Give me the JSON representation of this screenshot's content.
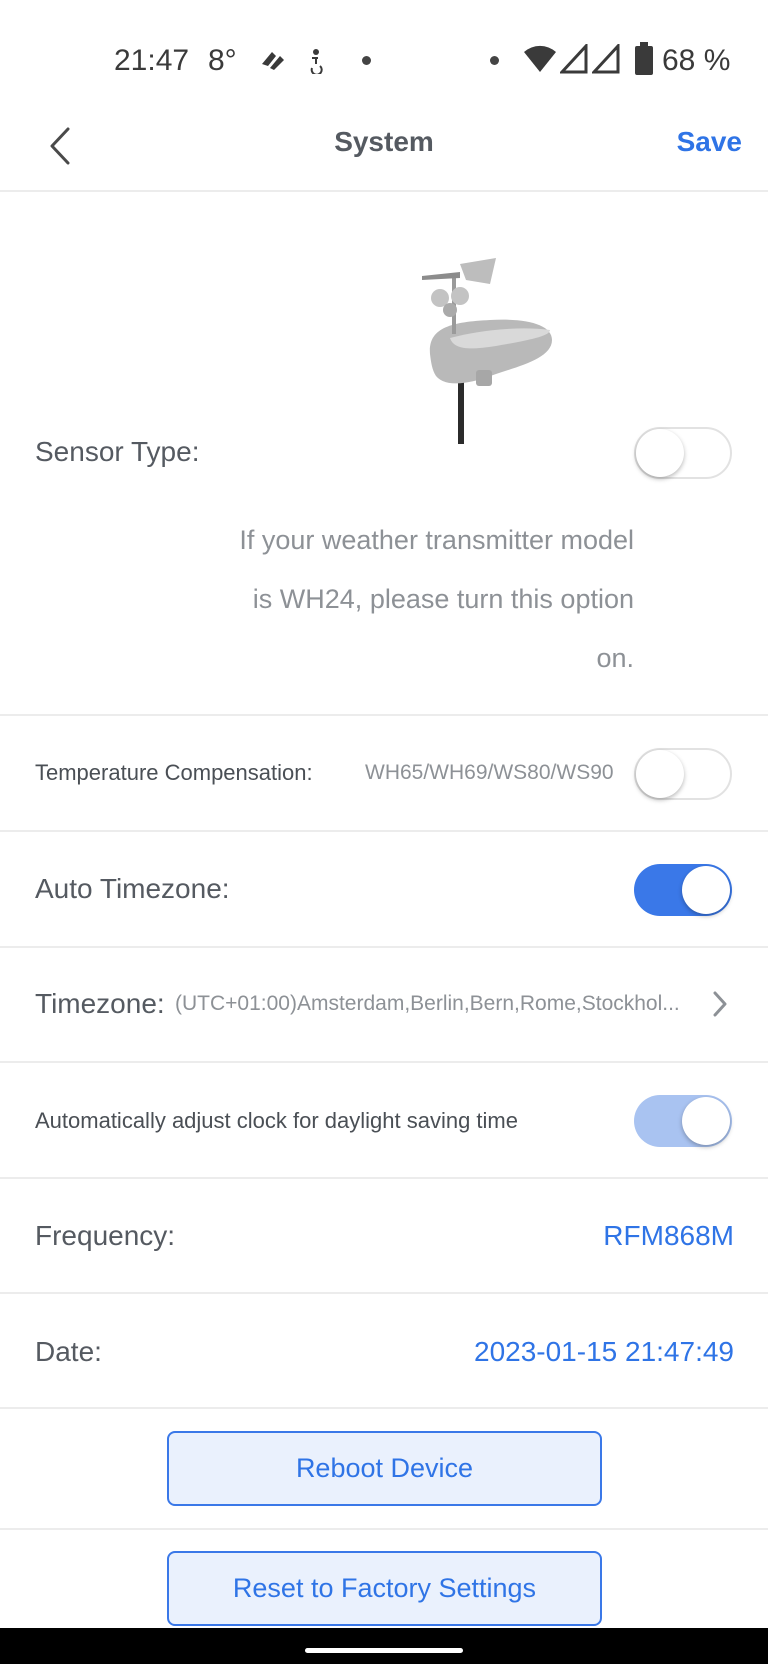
{
  "status_bar": {
    "time": "21:47",
    "temperature": "8°",
    "battery": "68 %",
    "icons": [
      "notification-icon",
      "accessibility-icon",
      "wifi-icon",
      "signal-icon",
      "signal-icon",
      "battery-icon"
    ]
  },
  "header": {
    "title": "System",
    "save_label": "Save",
    "back_icon": "chevron-left-icon"
  },
  "sensor_type": {
    "label": "Sensor Type:",
    "enabled": false,
    "hint_lines": [
      "If your weather transmitter model",
      "is WH24, please turn this option",
      "on."
    ]
  },
  "temperature_compensation": {
    "label": "Temperature Compensation:",
    "models": "WH65/WH69/WS80/WS90",
    "enabled": false
  },
  "auto_timezone": {
    "label": "Auto Timezone:",
    "enabled": true
  },
  "timezone": {
    "label": "Timezone:",
    "value": "(UTC+01:00)Amsterdam,Berlin,Bern,Rome,Stockhol..."
  },
  "dst": {
    "label": "Automatically adjust clock for daylight saving time",
    "enabled": true
  },
  "frequency": {
    "label": "Frequency:",
    "value": "RFM868M"
  },
  "date": {
    "label": "Date:",
    "value": "2023-01-15 21:47:49"
  },
  "buttons": {
    "reboot": "Reboot Device",
    "reset": "Reset to Factory Settings"
  },
  "colors": {
    "accent": "#2f74e6",
    "toggle_on": "#3a78e8",
    "toggle_on_disabled": "#a9c3f1",
    "text": "#555a61",
    "hint": "#8d9196"
  }
}
